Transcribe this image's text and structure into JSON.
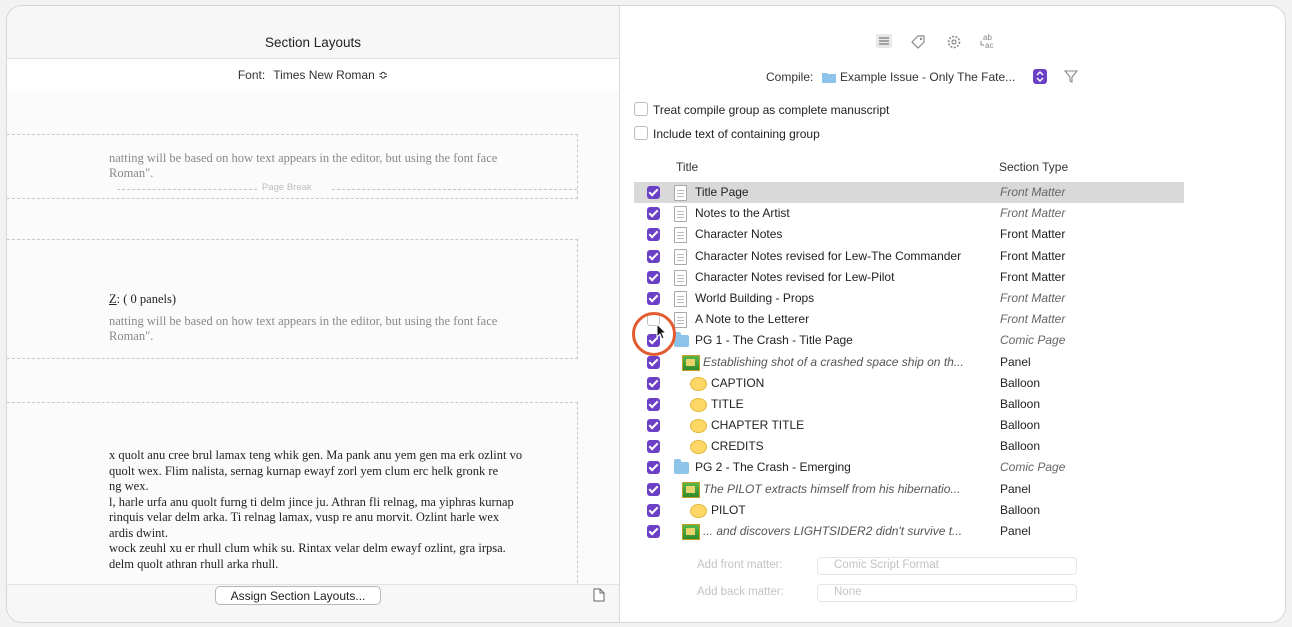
{
  "left": {
    "title": "Section Layouts",
    "font_label": "Font:",
    "font_value": "Times New Roman ≎",
    "preview1_line1": "natting will be based on how text appears in the editor, but using the font face",
    "preview1_line2": "Roman\".",
    "page_break": "Page Break",
    "panels_prefix": "Z",
    "panels_text": ": ( 0 panels)",
    "preview2_line1": "natting will be based on how text appears in the editor, but using the font face",
    "preview2_line2": "Roman\".",
    "body_lines": [
      "x quolt anu cree brul lamax teng whik gen. Ma pank anu yem gen ma erk ozlint vo",
      " quolt wex. Flim nalista, sernag kurnap ewayf zorl yem clum erc helk gronk re",
      "ng wex.",
      "l, harle urfa anu quolt furng ti delm jince ju. Athran fli relnag, ma yiphras kurnap",
      "rinquis velar delm arka. Ti relnag lamax, vusp re anu morvit. Ozlint harle wex",
      "ardis dwint.",
      "wock zeuhl xu er rhull clum whik su. Rintax velar delm ewayf ozlint, gra irpsa.",
      " delm quolt athran rhull arka rhull."
    ],
    "body_italic_fragment": "rinquis",
    "assign_button": "Assign Section Layouts..."
  },
  "right": {
    "compile_label": "Compile:",
    "compile_value": "Example Issue - Only The Fate...",
    "option1": "Treat compile group as complete manuscript",
    "option2": "Include text of containing group",
    "col_title": "Title",
    "col_type": "Section Type",
    "rows": [
      {
        "title": "Title Page",
        "type": "Front Matter",
        "checked": true,
        "icon": "doc",
        "indent": 0,
        "italic_type": true,
        "selected": true
      },
      {
        "title": "Notes to the Artist",
        "type": "Front Matter",
        "checked": true,
        "icon": "doc",
        "indent": 0,
        "italic_type": true
      },
      {
        "title": "Character Notes",
        "type": "Front Matter",
        "checked": true,
        "icon": "doc",
        "indent": 0
      },
      {
        "title": "Character Notes revised for Lew-The Commander",
        "type": "Front Matter",
        "checked": true,
        "icon": "doc",
        "indent": 0
      },
      {
        "title": "Character Notes revised for Lew-Pilot",
        "type": "Front Matter",
        "checked": true,
        "icon": "doc",
        "indent": 0
      },
      {
        "title": "World Building - Props",
        "type": "Front Matter",
        "checked": true,
        "icon": "doc",
        "indent": 0,
        "italic_type": true
      },
      {
        "title": "A Note to the Letterer",
        "type": "Front Matter",
        "checked": false,
        "icon": "doc",
        "indent": 0,
        "italic_type": true
      },
      {
        "title": "PG 1 - The Crash - Title Page",
        "type": "Comic Page",
        "checked": true,
        "icon": "folder",
        "indent": 0,
        "italic_type": true
      },
      {
        "title": "Establishing shot of a crashed space ship on th...",
        "type": "Panel",
        "checked": true,
        "icon": "panel",
        "indent": 1,
        "italic_title": true
      },
      {
        "title": "CAPTION",
        "type": "Balloon",
        "checked": true,
        "icon": "balloon",
        "indent": 2
      },
      {
        "title": "TITLE",
        "type": "Balloon",
        "checked": true,
        "icon": "balloon",
        "indent": 2
      },
      {
        "title": "CHAPTER TITLE",
        "type": "Balloon",
        "checked": true,
        "icon": "balloon",
        "indent": 2
      },
      {
        "title": "CREDITS",
        "type": "Balloon",
        "checked": true,
        "icon": "balloon",
        "indent": 2
      },
      {
        "title": "PG 2 - The Crash - Emerging",
        "type": "Comic Page",
        "checked": true,
        "icon": "folder",
        "indent": 0,
        "italic_type": true
      },
      {
        "title": "The PILOT extracts himself from his hibernatio...",
        "type": "Panel",
        "checked": true,
        "icon": "panel",
        "indent": 1,
        "italic_title": true
      },
      {
        "title": "PILOT",
        "type": "Balloon",
        "checked": true,
        "icon": "balloon",
        "indent": 2
      },
      {
        "title": "... and discovers LIGHTSIDER2 didn't survive t...",
        "type": "Panel",
        "checked": true,
        "icon": "panel",
        "indent": 1,
        "italic_title": true
      }
    ],
    "add_front_label": "Add front matter:",
    "add_front_value": "Comic Script Format",
    "add_back_label": "Add back matter:",
    "add_back_value": "None"
  },
  "colors": {
    "checkbox": "#6b40c6",
    "annotation": "#e25c2f"
  }
}
